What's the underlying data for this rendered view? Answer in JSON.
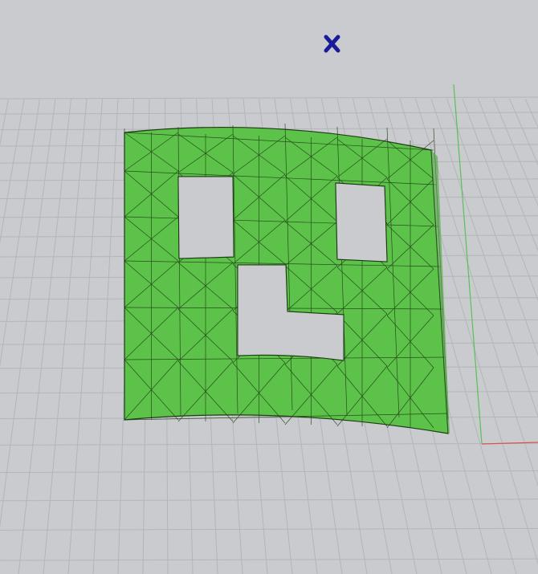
{
  "viewport": {
    "background_color": "#c9cbce",
    "grid_color": "#b4b7ba",
    "object_color": "#5cc24a",
    "marker_color": "#1a1a9a",
    "axis_x_color": "#d9544f",
    "axis_y_color": "#5cbf5c",
    "marker_icon": "x-cross-icon"
  }
}
